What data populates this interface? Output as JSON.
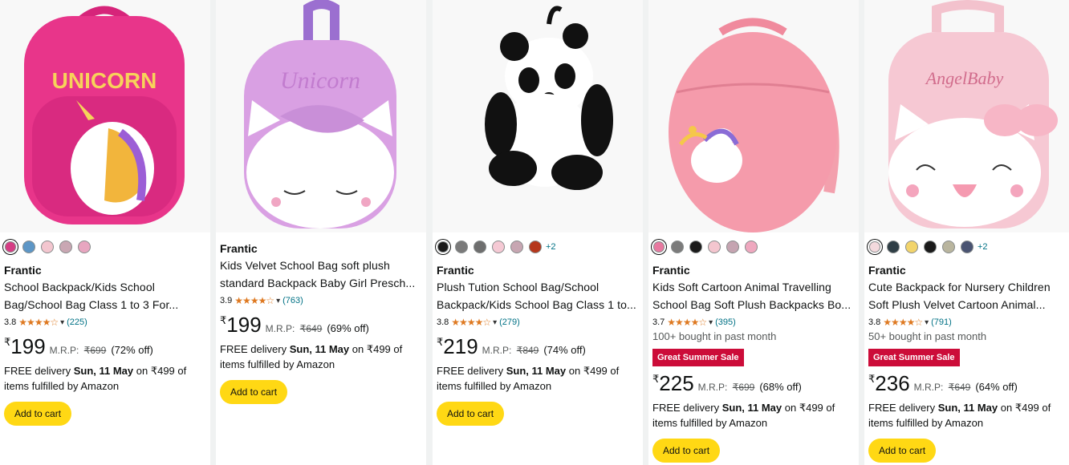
{
  "products": [
    {
      "swatches": [
        "#d63d84",
        "#5d96c6",
        "#f3c6cf",
        "#c9a7b3",
        "#e8a6c0"
      ],
      "more": "",
      "brand": "Frantic",
      "title_line1": "School Backpack/Kids School",
      "title_line2": "Bag/School Bag Class 1 to 3 For...",
      "rating": "3.8",
      "stars": "★★★★☆",
      "reviews": "(225)",
      "bought": "",
      "badge": "",
      "currency": "₹",
      "price": "199",
      "mrp_label": "M.R.P:",
      "mrp": "₹699",
      "discount": "(72% off)",
      "delivery_prefix": "FREE delivery",
      "delivery_date": "Sun, 11 May",
      "delivery_suffix": "on ₹499 of items fulfilled by Amazon",
      "cart": "Add to cart"
    },
    {
      "swatches": [],
      "more": "",
      "brand": "Frantic",
      "title_line1": "Kids Velvet School Bag soft plush",
      "title_line2": "standard Backpack Baby Girl Presch...",
      "rating": "3.9",
      "stars": "★★★★☆",
      "reviews": "(763)",
      "bought": "",
      "badge": "",
      "currency": "₹",
      "price": "199",
      "mrp_label": "M.R.P:",
      "mrp": "₹649",
      "discount": "(69% off)",
      "delivery_prefix": "FREE delivery",
      "delivery_date": "Sun, 11 May",
      "delivery_suffix": "on ₹499 of items fulfilled by Amazon",
      "cart": "Add to cart"
    },
    {
      "swatches": [
        "#1a1a1a",
        "#7a7a7a",
        "#6e6e6e",
        "#f5c9d4",
        "#c7a6b2",
        "#b5371c"
      ],
      "more": "+2",
      "brand": "Frantic",
      "title_line1": "Plush Tution School Bag/School",
      "title_line2": "Backpack/Kids School Bag Class 1 to...",
      "rating": "3.8",
      "stars": "★★★★☆",
      "reviews": "(279)",
      "bought": "",
      "badge": "",
      "currency": "₹",
      "price": "219",
      "mrp_label": "M.R.P:",
      "mrp": "₹849",
      "discount": "(74% off)",
      "delivery_prefix": "FREE delivery",
      "delivery_date": "Sun, 11 May",
      "delivery_suffix": "on ₹499 of items fulfilled by Amazon",
      "cart": "Add to cart"
    },
    {
      "swatches": [
        "#e879a0",
        "#7b7b7b",
        "#1a1a1a",
        "#f4c6cf",
        "#c5a4b1",
        "#efa8bf"
      ],
      "more": "",
      "brand": "Frantic",
      "title_line1": "Kids Soft Cartoon Animal Travelling",
      "title_line2": "School Bag Soft Plush Backpacks Bo...",
      "rating": "3.7",
      "stars": "★★★★☆",
      "reviews": "(395)",
      "bought": "100+ bought in past month",
      "badge": "Great Summer Sale",
      "currency": "₹",
      "price": "225",
      "mrp_label": "M.R.P:",
      "mrp": "₹699",
      "discount": "(68% off)",
      "delivery_prefix": "FREE delivery",
      "delivery_date": "Sun, 11 May",
      "delivery_suffix": "on ₹499 of items fulfilled by Amazon",
      "cart": "Add to cart"
    },
    {
      "swatches": [
        "#f3d9dd",
        "#2f3e46",
        "#f2d46c",
        "#1a1a1a",
        "#b9b59e",
        "#4a5472"
      ],
      "more": "+2",
      "brand": "Frantic",
      "title_line1": "Cute Backpack for Nursery Children",
      "title_line2": "Soft Plush Velvet Cartoon Animal...",
      "rating": "3.8",
      "stars": "★★★★☆",
      "reviews": "(791)",
      "bought": "50+ bought in past month",
      "badge": "Great Summer Sale",
      "currency": "₹",
      "price": "236",
      "mrp_label": "M.R.P:",
      "mrp": "₹649",
      "discount": "(64% off)",
      "delivery_prefix": "FREE delivery",
      "delivery_date": "Sun, 11 May",
      "delivery_suffix": "on ₹499 of items fulfilled by Amazon",
      "cart": "Add to cart"
    }
  ],
  "image_text": [
    "UNICORN",
    "Unicorn",
    "",
    "",
    "AngelBaby"
  ]
}
